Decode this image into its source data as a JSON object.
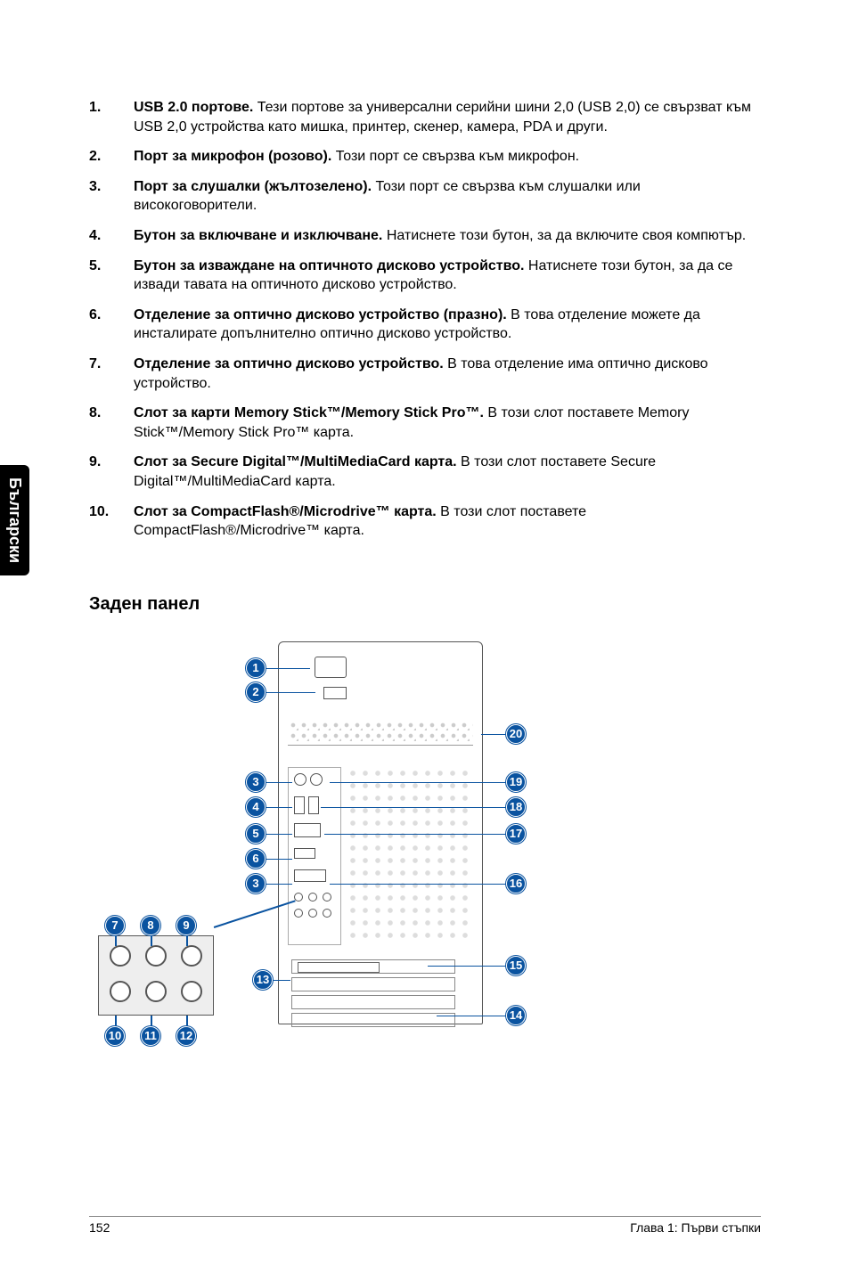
{
  "side_tab": "Български",
  "list": [
    {
      "num": "1.",
      "bold": "USB 2.0 портове.",
      "text": " Тези портове за универсални серийни шини 2,0 (USB 2,0) се свързват към USB 2,0 устройства като мишка, принтер, скенер, камера, PDA и други."
    },
    {
      "num": "2.",
      "bold": "Порт за микрофон (розово).",
      "text": " Този порт се свързва към микрофон."
    },
    {
      "num": "3.",
      "bold": "Порт за слушалки (жълтозелено).",
      "text": " Този порт се свързва към слушалки или високоговорители."
    },
    {
      "num": "4.",
      "bold": "Бутон за включване и изключване.",
      "text": " Натиснете този бутон, за да включите своя компютър."
    },
    {
      "num": "5.",
      "bold": "Бутон за изваждане на оптичното дисково устройство.",
      "text": " Натиснете този бутон, за да се извади тавата на оптичното дисково устройство."
    },
    {
      "num": "6.",
      "bold": "Отделение за оптично дисково устройство (празно).",
      "text": " В това отделение можете да инсталирате допълнително оптично дисково устройство."
    },
    {
      "num": "7.",
      "bold": "Отделение за оптично дисково устройство.",
      "text": " В това отделение има оптично дисково устройство."
    },
    {
      "num": "8.",
      "bold": "Слот за карти Memory Stick™/Memory Stick Pro™.",
      "text": " В този слот поставете Memory Stick™/Memory Stick Pro™ карта."
    },
    {
      "num": "9.",
      "bold": "Слот за Secure Digital™/MultiMediaCard карта.",
      "text": " В този слот поставете Secure Digital™/MultiMediaCard карта."
    },
    {
      "num": "10.",
      "bold": "Слот за CompactFlash®/Microdrive™ карта.",
      "text": " В този слот поставете CompactFlash®/Microdrive™ карта."
    }
  ],
  "section_title": "Заден панел",
  "callouts_left": {
    "c1": "1",
    "c2": "2",
    "c3a": "3",
    "c4": "4",
    "c5": "5",
    "c6": "6",
    "c3b": "3",
    "c7": "7",
    "c8": "8",
    "c9": "9",
    "c10": "10",
    "c11": "11",
    "c12": "12",
    "c13": "13"
  },
  "callouts_right": {
    "c20": "20",
    "c19": "19",
    "c18": "18",
    "c17": "17",
    "c16": "16",
    "c15": "15",
    "c14": "14"
  },
  "footer": {
    "page": "152",
    "chapter": "Глава 1: Първи стъпки"
  }
}
